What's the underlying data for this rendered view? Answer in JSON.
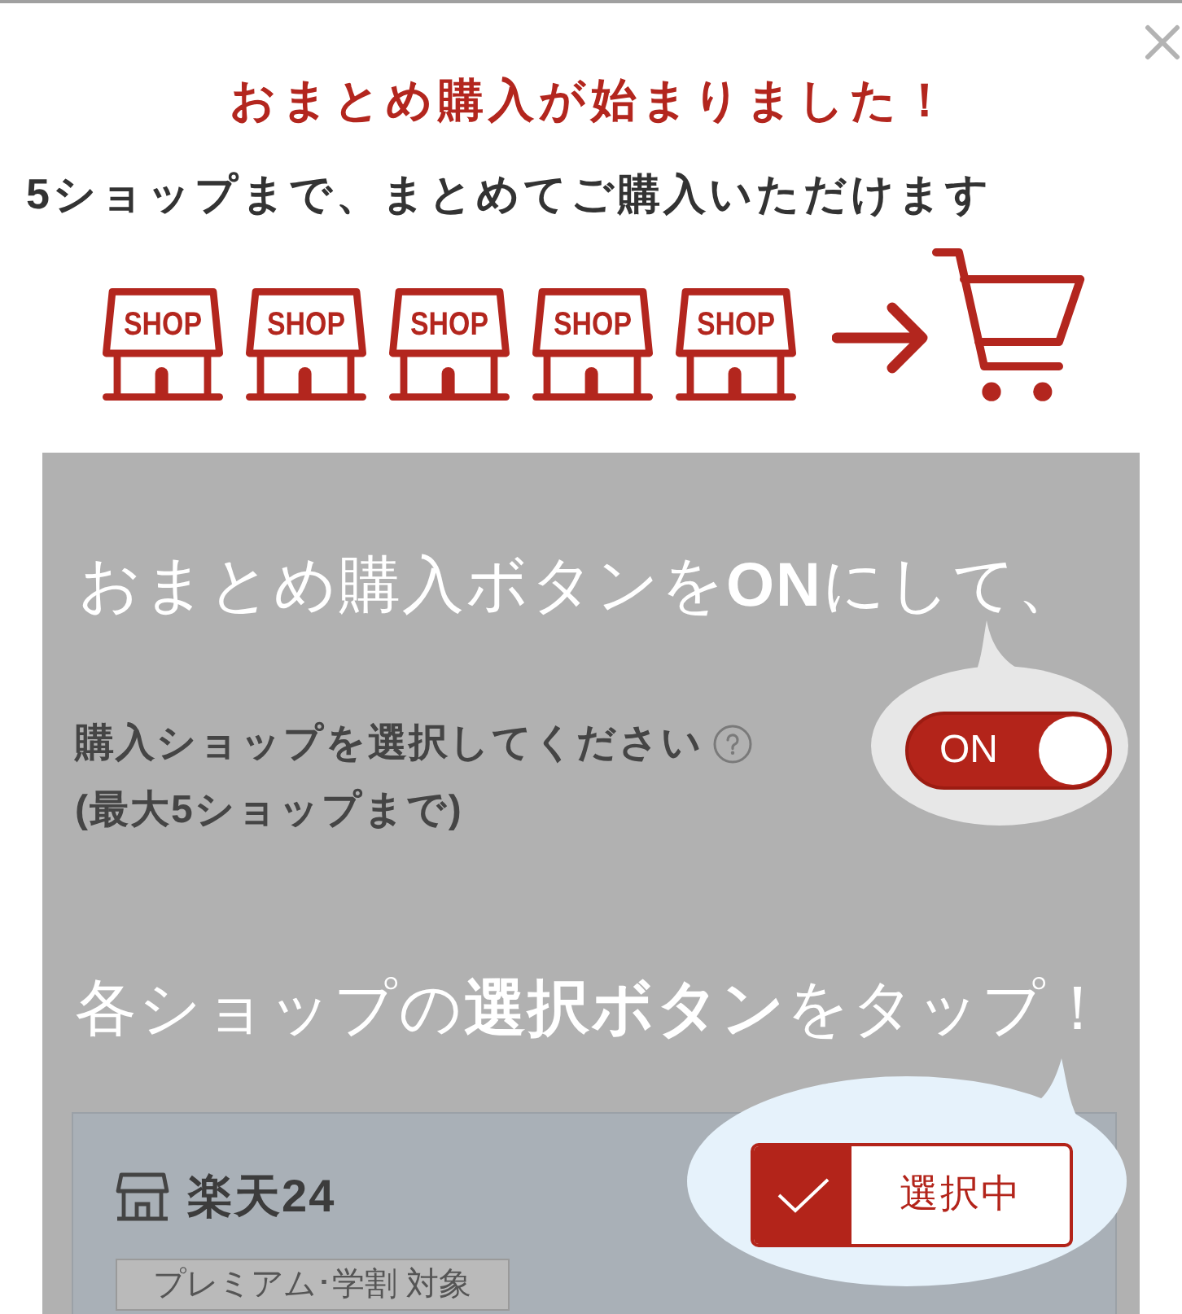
{
  "title": "おまとめ購入が始まりました！",
  "subtitle": "5ショップまで、まとめてご購入いただけます",
  "illustration": {
    "shop_labels": [
      "SHOP",
      "SHOP",
      "SHOP",
      "SHOP",
      "SHOP"
    ]
  },
  "tutorial": {
    "step_1": {
      "heading": "おまとめ購入ボタンを**ON**にして、",
      "instruction": "購入ショップを選択してください",
      "note": "(最大5ショップまで)",
      "toggle": {
        "label": "ON",
        "on": true
      }
    },
    "step_2": {
      "heading": "各ショップの**選択ボタン**をタップ！",
      "shop_card": {
        "name": "楽天24",
        "tag": "プレミアム･学割 対象",
        "select_button": {
          "label": "選択中",
          "selected": true
        }
      }
    }
  }
}
